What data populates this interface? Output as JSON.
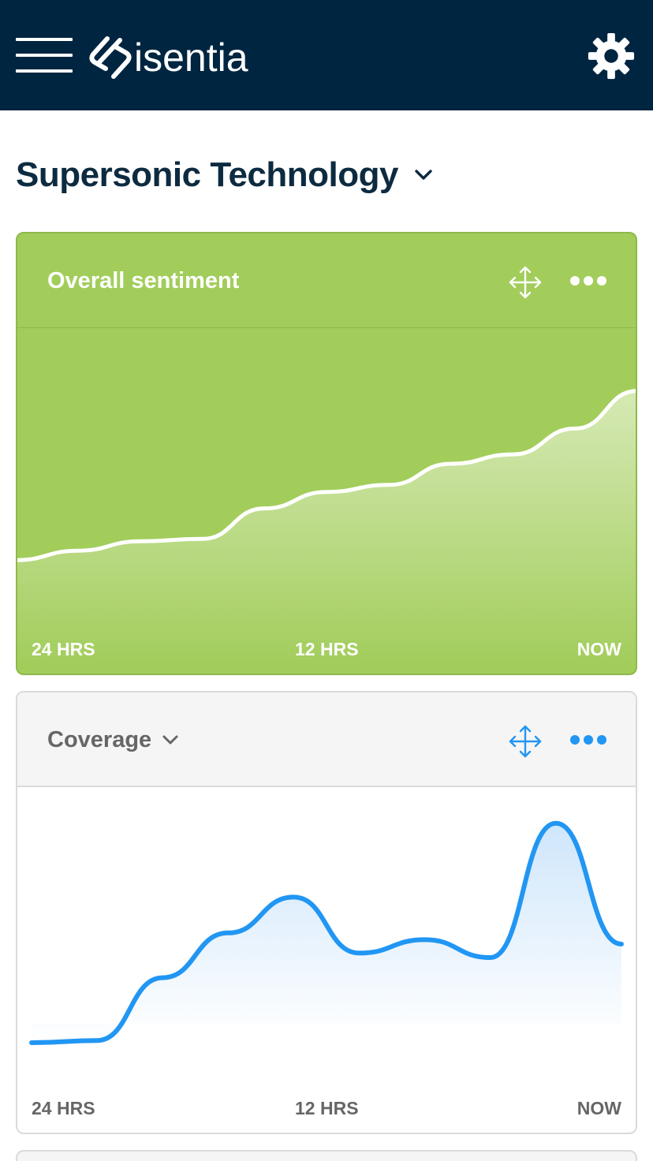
{
  "header": {
    "brand": "isentia",
    "menu_icon": "hamburger-icon",
    "logo_icon": "isentia-logo-icon",
    "settings_icon": "gear-icon",
    "background": "#002540"
  },
  "page": {
    "title": "Supersonic Technology"
  },
  "cards": {
    "sentiment": {
      "title": "Overall sentiment",
      "background": "#a2cd5b",
      "axis": {
        "left": "24 HRS",
        "middle": "12 HRS",
        "right": "NOW"
      }
    },
    "coverage": {
      "title": "Coverage",
      "accent": "#2196f3",
      "axis": {
        "left": "24 HRS",
        "middle": "12 HRS",
        "right": "NOW"
      }
    }
  },
  "chart_data": [
    {
      "type": "area",
      "title": "Overall sentiment",
      "x": [
        "24 HRS",
        "",
        "",
        "",
        "",
        "12 HRS",
        "",
        "",
        "",
        "",
        "NOW"
      ],
      "series": [
        {
          "values": [
            0.08,
            0.12,
            0.16,
            0.17,
            0.3,
            0.37,
            0.4,
            0.49,
            0.53,
            0.64,
            0.8
          ]
        }
      ],
      "ylim": [
        0,
        1
      ],
      "grid": false
    },
    {
      "type": "area",
      "title": "Coverage",
      "x": [
        "24 HRS",
        "",
        "",
        "",
        "",
        "12 HRS",
        "",
        "",
        "",
        "",
        "NOW"
      ],
      "series": [
        {
          "values": [
            0.0,
            0.01,
            0.29,
            0.49,
            0.65,
            0.4,
            0.46,
            0.38,
            0.98,
            0.44
          ]
        }
      ],
      "ylim": [
        0,
        1
      ],
      "grid": false
    }
  ]
}
